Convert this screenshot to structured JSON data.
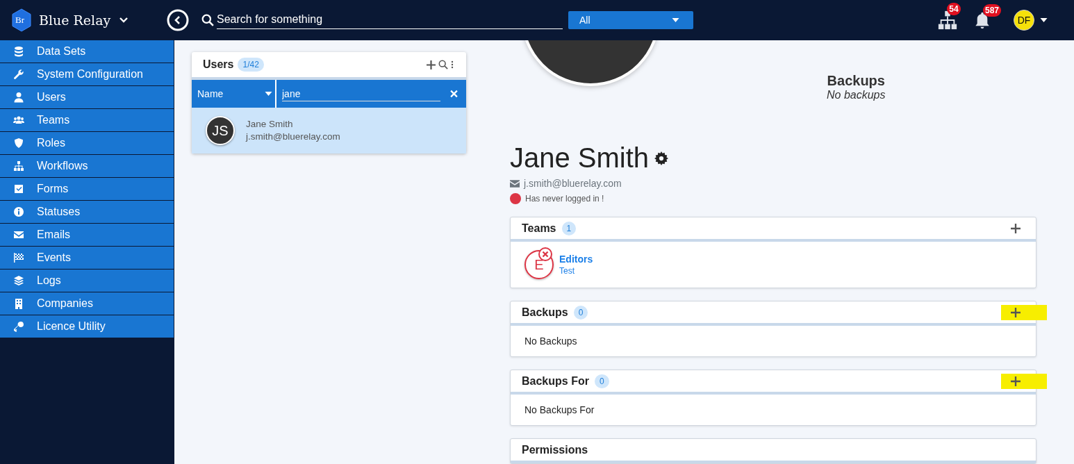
{
  "app": {
    "logo_text": "Br",
    "name": "Blue Relay"
  },
  "search": {
    "placeholder": "Search for something"
  },
  "scope_select": {
    "value": "All"
  },
  "header_badges": [
    {
      "count": "54"
    },
    {
      "count": "587"
    }
  ],
  "user_menu": {
    "initials": "DF"
  },
  "sidebar": {
    "items": [
      {
        "label": "Data Sets"
      },
      {
        "label": "System Configuration"
      },
      {
        "label": "Users"
      },
      {
        "label": "Teams"
      },
      {
        "label": "Roles"
      },
      {
        "label": "Workflows"
      },
      {
        "label": "Forms"
      },
      {
        "label": "Statuses"
      },
      {
        "label": "Emails"
      },
      {
        "label": "Events"
      },
      {
        "label": "Logs"
      },
      {
        "label": "Companies"
      },
      {
        "label": "Licence Utility"
      }
    ]
  },
  "users_panel": {
    "title": "Users",
    "count": "1/42",
    "filter_field": "Name",
    "filter_value": "jane",
    "rows": [
      {
        "initials": "JS",
        "name": "Jane Smith",
        "email": "j.smith@bluerelay.com",
        "selected": true
      }
    ]
  },
  "profile": {
    "backups_title": "Backups",
    "backups_note": "No backups",
    "name": "Jane Smith",
    "email": "j.smith@bluerelay.com",
    "login_status": "Has never logged in !",
    "sections": [
      {
        "title": "Teams",
        "count": "1",
        "kind": "list",
        "add_highlighted": false,
        "items": [
          {
            "initial": "E",
            "name": "Editors",
            "subtitle": "Test"
          }
        ]
      },
      {
        "title": "Backups",
        "count": "0",
        "kind": "empty",
        "add_highlighted": true,
        "empty_text": "No Backups"
      },
      {
        "title": "Backups For",
        "count": "0",
        "kind": "empty",
        "add_highlighted": true,
        "empty_text": "No Backups For"
      },
      {
        "title": "Permissions",
        "kind": "header"
      }
    ]
  }
}
